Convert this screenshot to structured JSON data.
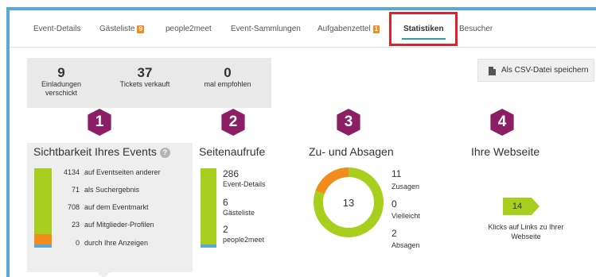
{
  "tabs": [
    {
      "label": "Event-Details"
    },
    {
      "label": "Gästeliste",
      "badge": "9"
    },
    {
      "label": "people2meet"
    },
    {
      "label": "Event-Sammlungen"
    },
    {
      "label": "Aufgabenzettel",
      "badge": "1"
    },
    {
      "label": "Statistiken",
      "active": true
    },
    {
      "label": "Besucher"
    }
  ],
  "summary": [
    {
      "value": "9",
      "label": "Einladungen verschickt"
    },
    {
      "value": "37",
      "label": "Tickets verkauft"
    },
    {
      "value": "0",
      "label": "mal empfohlen"
    }
  ],
  "csv_button": {
    "label": "Als CSV-Datei speichern",
    "icon": "document-icon"
  },
  "sections": [
    {
      "number": "1",
      "title": "Sichtbarkeit Ihres Events"
    },
    {
      "number": "2",
      "title": "Seitenaufrufe"
    },
    {
      "number": "3",
      "title": "Zu- und Absagen"
    },
    {
      "number": "4",
      "title": "Ihre Webseite"
    }
  ],
  "visibility": {
    "help_icon": "?",
    "rows": [
      {
        "value": "4134",
        "label": "auf Eventseiten anderer"
      },
      {
        "value": "71",
        "label": "als Suchergebnis"
      },
      {
        "value": "708",
        "label": "auf dem Eventmarkt"
      },
      {
        "value": "23",
        "label": "auf Mitglieder-Profilen"
      },
      {
        "value": "0",
        "label": "durch Ihre Anzeigen"
      }
    ]
  },
  "page_views": [
    {
      "value": "286",
      "label": "Event-Details"
    },
    {
      "value": "6",
      "label": "Gästeliste"
    },
    {
      "value": "2",
      "label": "people2meet"
    }
  ],
  "rsvp": {
    "total": "13",
    "items": [
      {
        "value": "11",
        "label": "Zusagen"
      },
      {
        "value": "0",
        "label": "Vielleicht"
      },
      {
        "value": "2",
        "label": "Absagen"
      }
    ]
  },
  "website": {
    "clicks": "14",
    "label": "Klicks auf Links zu Ihrer Webseite"
  },
  "colors": {
    "accent_green": "#a8cf1e",
    "accent_orange": "#f28c1c",
    "accent_blue": "#5aa8d8",
    "section_purple": "#8c1e66",
    "tab_underline": "#2f9e9a",
    "highlight_red": "#e0202a"
  }
}
